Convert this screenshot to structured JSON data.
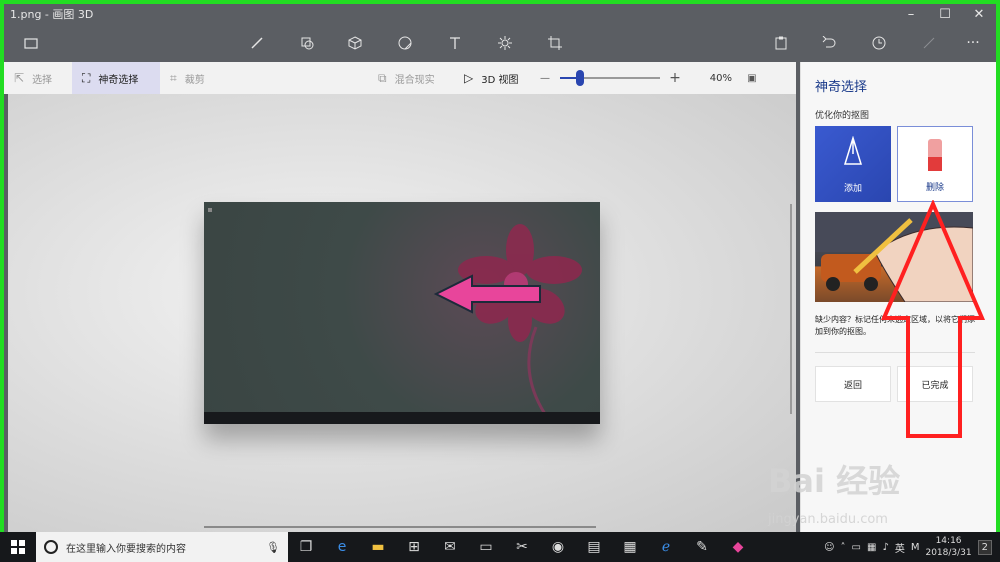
{
  "window": {
    "title": "1.png - 画图 3D",
    "minimize": "–",
    "maximize": "☐",
    "close": "✕"
  },
  "toolbar": {
    "menu_icon": "folder-icon",
    "tools": [
      "brush-icon",
      "2d-shapes-icon",
      "3d-shapes-icon",
      "stickers-icon",
      "text-icon",
      "effects-icon",
      "canvas-icon"
    ],
    "right": [
      "paste-icon",
      "undo-icon",
      "history-icon",
      "redo-icon",
      "more-icon"
    ],
    "more_label": "···"
  },
  "subbar": {
    "select": "选择",
    "magic_select": "神奇选择",
    "crop": "裁剪",
    "mixed_reality": "混合现实",
    "view_3d": "3D 视图",
    "zoom_minus": "—",
    "zoom_plus": "+",
    "zoom_level": "40%",
    "zoom_value_pct": 40
  },
  "panel": {
    "title": "神奇选择",
    "subtitle": "优化你的抠图",
    "add_label": "添加",
    "erase_label": "删除",
    "hint": "缺少内容？标记任何未选定区域，以将它们添加到你的抠图。",
    "back_label": "返回",
    "done_label": "已完成"
  },
  "watermark": {
    "logo": "Bai 经验",
    "url": "jingyan.baidu.com"
  },
  "os_taskbar": {
    "search_placeholder": "在这里输入你要搜索的内容",
    "input_lang": "英",
    "ime": "M",
    "time": "14:16",
    "date": "2018/3/31",
    "notifications": "2"
  },
  "colors": {
    "frame_green": "#22dd22",
    "accent_blue": "#2a46b0",
    "annotation_red": "#ff2020"
  }
}
